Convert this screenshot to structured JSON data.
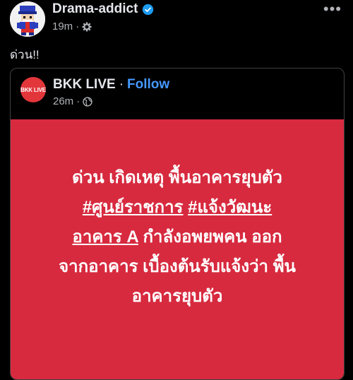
{
  "post": {
    "author": "Drama-addict",
    "time": "19m",
    "dot": "·",
    "text": "ด่วน!!"
  },
  "shared": {
    "page_name": "BKK LIVE",
    "dot": "·",
    "follow": "Follow",
    "time": "26m",
    "logo_text": "BKK LIVE",
    "banner": {
      "line1": "ด่วน เกิดเหตุ พื้นอาคารยุบตัว",
      "line2_a": "#ศูนย์ราชการ",
      "line2_b": " ",
      "line2_c": "#แจ้งวัฒนะ",
      "line3_a": "อาคาร A",
      "line3_b": " กำลังอพยพคน ออก",
      "line4": "จากอาคาร เบื้องต้นรับแจ้งว่า พื้น",
      "line5": "อาคารยุบตัว"
    },
    "banner_color": "#d72a3f"
  },
  "colors": {
    "link": "#4599ff",
    "verified": "#1d9bf0"
  }
}
